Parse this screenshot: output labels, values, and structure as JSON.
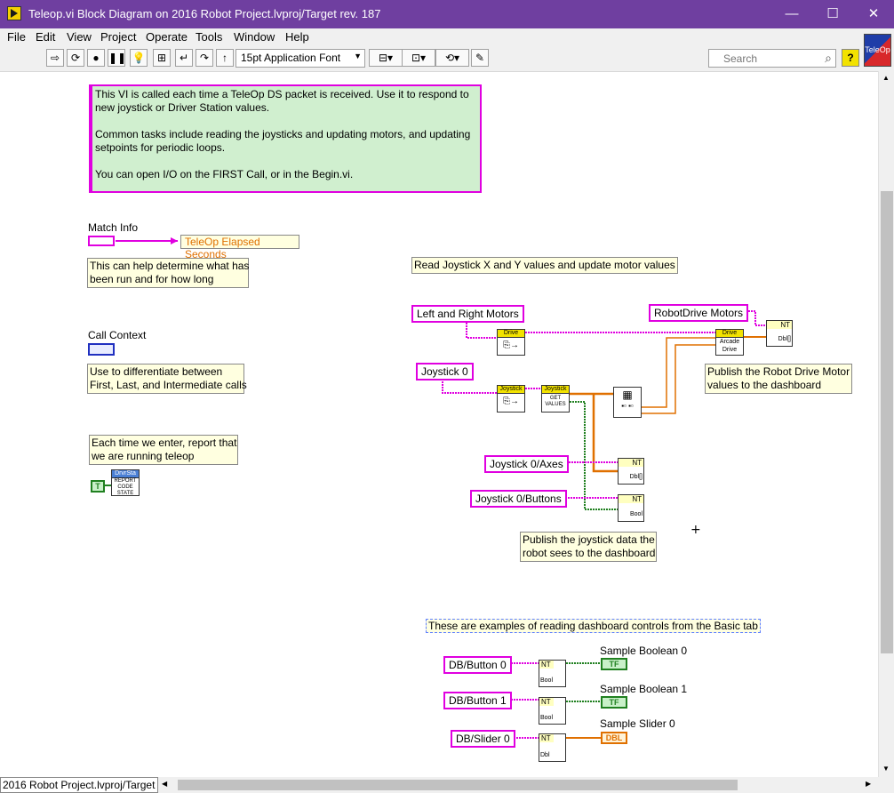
{
  "window": {
    "title": "Teleop.vi Block Diagram on 2016 Robot Project.lvproj/Target rev. 187",
    "buttons": {
      "minimize": "—",
      "maximize": "☐",
      "close": "✕"
    }
  },
  "menu": [
    "File",
    "Edit",
    "View",
    "Project",
    "Operate",
    "Tools",
    "Window",
    "Help"
  ],
  "toolbar": {
    "font": "15pt Application Font",
    "search_placeholder": "Search",
    "help": "?"
  },
  "vi_icon_label": "TeleOp",
  "status_path": "2016 Robot Project.lvproj/Target",
  "diagram": {
    "main_comment": [
      "This VI is called each time a TeleOp DS packet is received.  Use it to respond to",
      "new joystick or Driver Station values.",
      "",
      "Common tasks include reading the joysticks and updating motors, and updating",
      "setpoints for periodic loops.",
      "",
      "You can open I/O on the FIRST Call, or in the Begin.vi."
    ],
    "match_info": {
      "label": "Match Info",
      "unbundle": "TeleOp Elapsed Seconds",
      "note": [
        "This can help determine what has",
        "been run and for how long"
      ]
    },
    "call_context": {
      "label": "Call Context",
      "note": [
        "Use to differentiate between",
        "First, Last, and Intermediate calls"
      ]
    },
    "report": {
      "note": [
        "Each time we enter, report that",
        "we are running teleop"
      ],
      "bool_const": "T",
      "vi_header": "DrvrSta",
      "vi_body": "REPORT CODE STATE"
    },
    "joystick_section": {
      "title": "Read Joystick X and Y values and update motor values",
      "left_right_motors": "Left and Right Motors",
      "robotdrive_motors": "RobotDrive Motors",
      "joystick0": "Joystick 0",
      "joystick0_axes": "Joystick 0/Axes",
      "joystick0_buttons": "Joystick 0/Buttons",
      "drive_hdr": "Drive",
      "arcade_hdr": "Drive",
      "arcade_body": "Arcade Drive",
      "joystick_hdr": "Joystick",
      "get_values_hdr": "Joystick",
      "get_values_body": "GET VALUES",
      "nt_label": "NT",
      "dbl_array": "Dbl[]",
      "bool": "Bool",
      "note_publish_motor": [
        "Publish the Robot Drive Motor",
        "values to the dashboard"
      ],
      "note_publish_joystick": [
        "Publish the joystick data the",
        "robot sees to the dashboard"
      ]
    },
    "dashboard_section": {
      "title": "These are examples of reading dashboard controls from the Basic tab",
      "rows": [
        {
          "control": "DB/Button 0",
          "type": "Bool",
          "indicator_label": "Sample Boolean 0",
          "indicator": "TF"
        },
        {
          "control": "DB/Button 1",
          "type": "Bool",
          "indicator_label": "Sample Boolean 1",
          "indicator": "TF"
        },
        {
          "control": "DB/Slider 0",
          "type": "Dbl",
          "indicator_label": "Sample Slider 0",
          "indicator": "DBL"
        }
      ]
    }
  },
  "colors": {
    "titlebar": "#6f3fa0",
    "comment_bg": "#d0efcf",
    "comment_border": "#e000e0",
    "wire_pink": "#e000e0",
    "wire_orange": "#e07000",
    "wire_green": "#208020",
    "note_bg": "#ffffe0"
  }
}
